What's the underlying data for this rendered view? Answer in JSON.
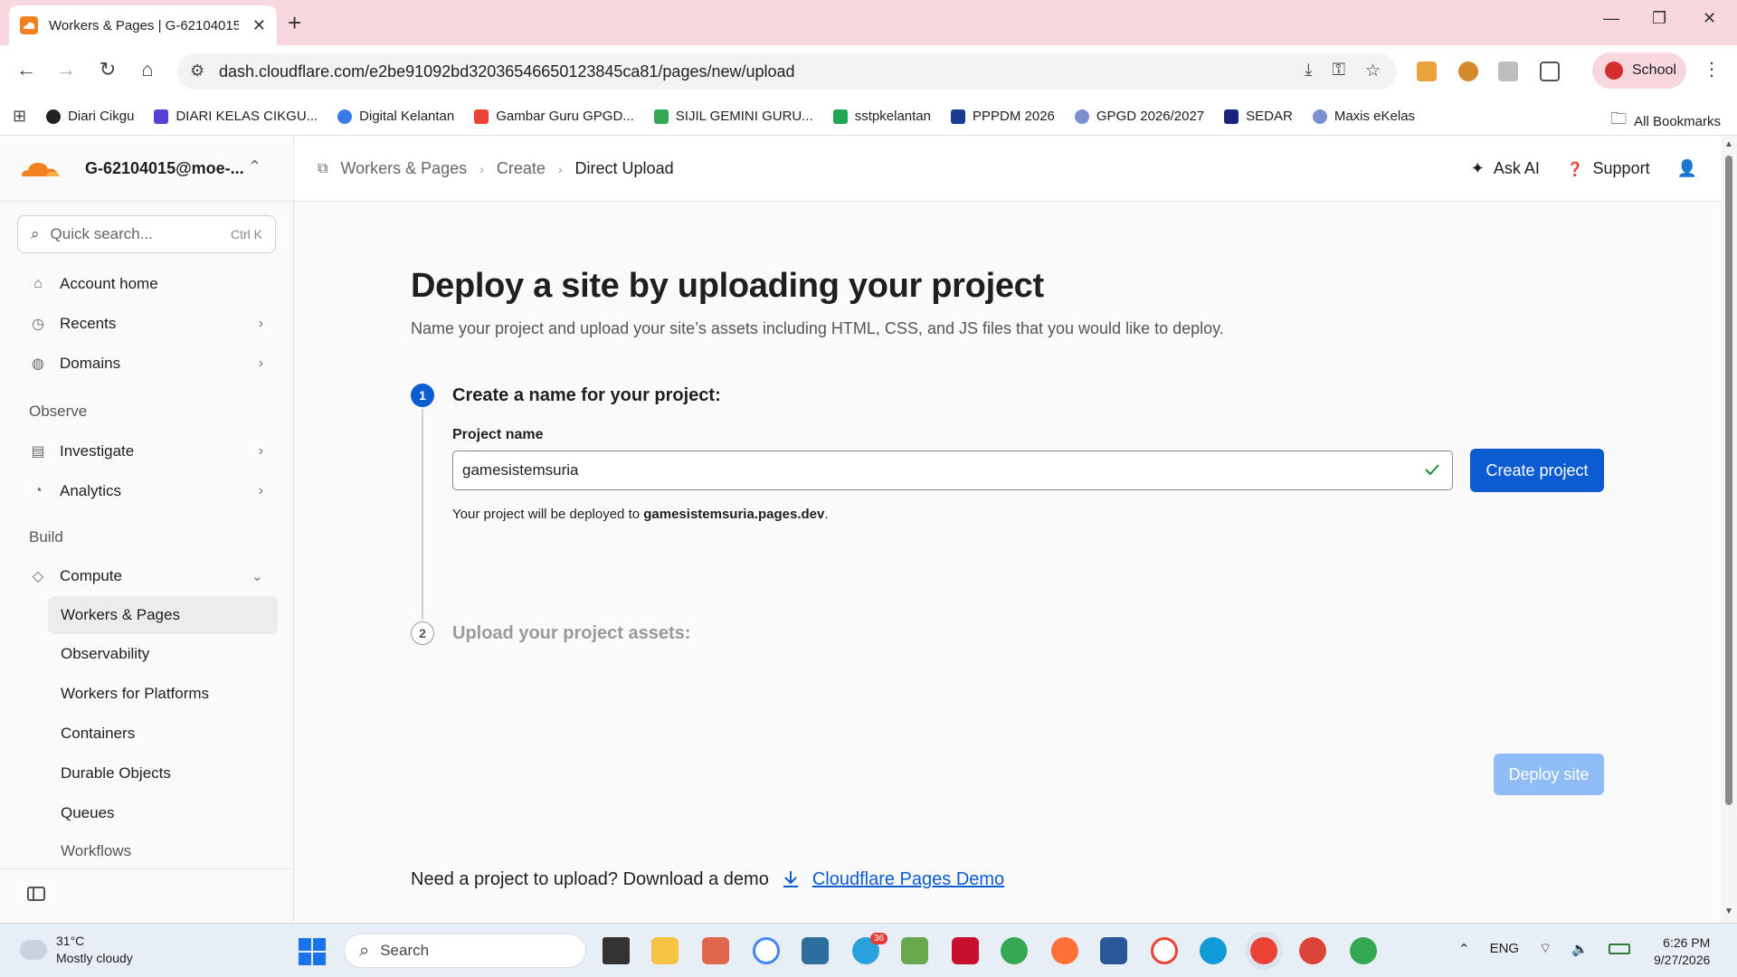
{
  "browser": {
    "tab_title": "Workers & Pages | G-62104015",
    "url": "dash.cloudflare.com/e2be91092bd32036546650123845ca81/pages/new/upload",
    "profile_label": "School",
    "bookmarks": [
      {
        "label": "Diari Cikgu",
        "color": "#202124"
      },
      {
        "label": "DIARI KELAS CIKGU...",
        "color": "#5b3fd1"
      },
      {
        "label": "Digital Kelantan",
        "color": "#3b7be8"
      },
      {
        "label": "Gambar Guru GPGD...",
        "color": "#ea4335"
      },
      {
        "label": "SIJIL GEMINI GURU...",
        "color": "#34a853"
      },
      {
        "label": "sstpkelantan",
        "color": "#1fa84f"
      },
      {
        "label": "PPPDM 2026",
        "color": "#1a3d8f"
      },
      {
        "label": "GPGD 2026/2027",
        "color": "#7b8fd1"
      },
      {
        "label": "SEDAR",
        "color": "#1a237e"
      },
      {
        "label": "Maxis eKelas",
        "color": "#7b8fd1"
      }
    ],
    "all_bookmarks_label": "All Bookmarks"
  },
  "sidebar": {
    "account_name": "G-62104015@moe-...",
    "search_placeholder": "Quick search...",
    "search_shortcut": "Ctrl K",
    "items": [
      {
        "label": "Account home",
        "icon": "home-icon"
      },
      {
        "label": "Recents",
        "icon": "clock-icon"
      },
      {
        "label": "Domains",
        "icon": "globe-icon"
      }
    ],
    "section_observe": "Observe",
    "observe_items": [
      {
        "label": "Investigate",
        "icon": "investigate-icon"
      },
      {
        "label": "Analytics",
        "icon": "analytics-icon"
      }
    ],
    "section_build": "Build",
    "compute_label": "Compute",
    "compute_items": [
      "Workers & Pages",
      "Observability",
      "Workers for Platforms",
      "Containers",
      "Durable Objects",
      "Queues",
      "Workflows"
    ]
  },
  "header": {
    "breadcrumb": [
      "Workers & Pages",
      "Create",
      "Direct Upload"
    ],
    "ask_ai": "Ask AI",
    "support": "Support"
  },
  "main": {
    "title": "Deploy a site by uploading your project",
    "subtitle": "Name your project and upload your site’s assets including HTML, CSS, and JS files that you would like to deploy.",
    "step1_number": "1",
    "step1_title": "Create a name for your project:",
    "project_name_label": "Project name",
    "project_name_value": "gamesistemsuria",
    "create_button": "Create project",
    "deploy_note_prefix": "Your project will be deployed to ",
    "deploy_note_domain": "gamesistemsuria.pages.dev",
    "deploy_note_suffix": ".",
    "step2_number": "2",
    "step2_title": "Upload your project assets:",
    "deploy_button": "Deploy site",
    "demo_text": "Need a project to upload? Download a demo",
    "demo_link": "Cloudflare Pages Demo"
  },
  "taskbar": {
    "temperature": "31°C",
    "weather": "Mostly cloudy",
    "search_label": "Search",
    "language": "ENG",
    "time": "6:26 PM",
    "date": "9/27/2026",
    "telegram_badge": "36"
  },
  "colors": {
    "accent": "#0b5cd0",
    "cloudflare_orange": "#f38020",
    "tab_strip": "#f8d7df"
  }
}
